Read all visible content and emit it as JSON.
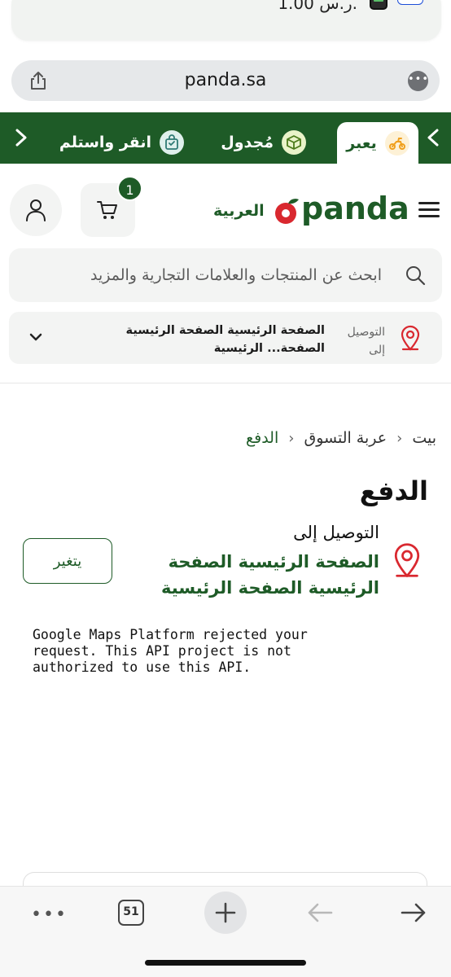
{
  "notification": {
    "amount": "1.00 ر.س.",
    "wallet_icon": "wallet-icon"
  },
  "browser": {
    "url": "panda.sa",
    "tab_count": "51"
  },
  "delivery_tabs": [
    {
      "label": "يعبر",
      "icon": "scooter-icon",
      "active": true
    },
    {
      "label": "مُجدول",
      "icon": "box-icon",
      "active": false
    },
    {
      "label": "انقر واستلم",
      "icon": "bag-icon",
      "active": false
    }
  ],
  "header": {
    "brand": "panda",
    "language": "العربية",
    "cart_count": "1"
  },
  "search": {
    "placeholder": "ابحث عن المنتجات والعلامات التجارية والمزيد"
  },
  "location": {
    "label": "التوصيل إلى",
    "address": "الصفحة الرئيسية الصفحة الرئيسية الصفحة... الرئيسية"
  },
  "breadcrumb": {
    "home": "بيت",
    "cart": "عربة التسوق",
    "current": "الدفع"
  },
  "page_title": "الدفع",
  "delivery": {
    "label": "التوصيل إلى",
    "address": "الصفحة الرئيسية الصفحة الرئيسية الصفحة الرئيسية",
    "change_label": "يتغير"
  },
  "maps_error": "Google Maps Platform rejected your\nrequest. This API project is not\nauthorized to use this API.",
  "colors": {
    "brand_green": "#1e5b27",
    "brand_red": "#d9282f",
    "scooter_orange": "#f0a01e"
  }
}
